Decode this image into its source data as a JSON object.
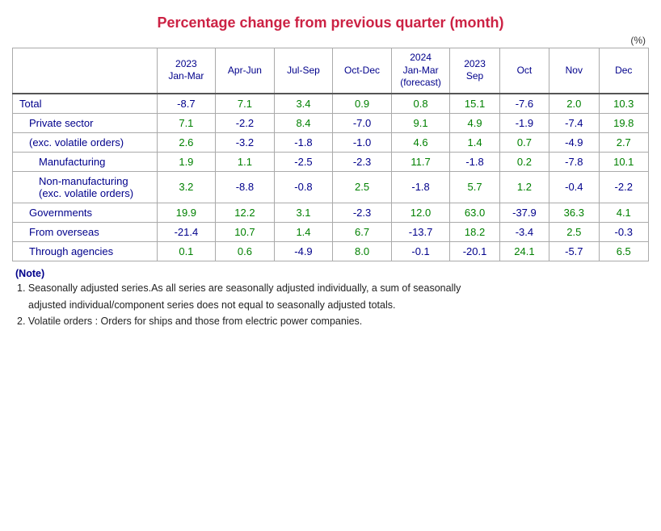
{
  "title": "Percentage change from previous quarter (month)",
  "unit": "(%)",
  "columns": {
    "row_label": "",
    "col1": {
      "line1": "2023",
      "line2": "Jan-Mar"
    },
    "col2": {
      "line1": "Apr-Jun",
      "line2": ""
    },
    "col3": {
      "line1": "Jul-Sep",
      "line2": ""
    },
    "col4": {
      "line1": "Oct-Dec",
      "line2": ""
    },
    "col5": {
      "line1": "2024",
      "line2": "Jan-Mar",
      "line3": "(forecast)"
    },
    "col6": {
      "line1": "2023",
      "line2": "Sep"
    },
    "col7": {
      "line1": "Oct",
      "line2": ""
    },
    "col8": {
      "line1": "Nov",
      "line2": ""
    },
    "col9": {
      "line1": "Dec",
      "line2": ""
    }
  },
  "rows": [
    {
      "label": "Total",
      "indent": 0,
      "values": [
        "-8.7",
        "7.1",
        "3.4",
        "0.9",
        "0.8",
        "15.1",
        "-7.6",
        "2.0",
        "10.3"
      ]
    },
    {
      "label": "Private sector",
      "indent": 1,
      "values": [
        "7.1",
        "-2.2",
        "8.4",
        "-7.0",
        "9.1",
        "4.9",
        "-1.9",
        "-7.4",
        "19.8"
      ]
    },
    {
      "label": "(exc. volatile orders)",
      "indent": 1,
      "values": [
        "2.6",
        "-3.2",
        "-1.8",
        "-1.0",
        "4.6",
        "1.4",
        "0.7",
        "-4.9",
        "2.7"
      ]
    },
    {
      "label": "Manufacturing",
      "indent": 2,
      "values": [
        "1.9",
        "1.1",
        "-2.5",
        "-2.3",
        "11.7",
        "-1.8",
        "0.2",
        "-7.8",
        "10.1"
      ]
    },
    {
      "label": "Non-manufacturing\n(exc. volatile orders)",
      "indent": 2,
      "values": [
        "3.2",
        "-8.8",
        "-0.8",
        "2.5",
        "-1.8",
        "5.7",
        "1.2",
        "-0.4",
        "-2.2"
      ]
    },
    {
      "label": "Governments",
      "indent": 1,
      "values": [
        "19.9",
        "12.2",
        "3.1",
        "-2.3",
        "12.0",
        "63.0",
        "-37.9",
        "36.3",
        "4.1"
      ]
    },
    {
      "label": "From overseas",
      "indent": 1,
      "values": [
        "-21.4",
        "10.7",
        "1.4",
        "6.7",
        "-13.7",
        "18.2",
        "-3.4",
        "2.5",
        "-0.3"
      ]
    },
    {
      "label": "Through agencies",
      "indent": 1,
      "values": [
        "0.1",
        "0.6",
        "-4.9",
        "8.0",
        "-0.1",
        "-20.1",
        "24.1",
        "-5.7",
        "6.5"
      ]
    }
  ],
  "notes_title": "(Note)",
  "note1": "1. Seasonally adjusted series.As all series are seasonally adjusted individually,  a sum of seasonally",
  "note1b": "   adjusted individual/component series does not equal to seasonally adjusted totals.",
  "note2": "2. Volatile orders : Orders for ships and those from electric power companies."
}
